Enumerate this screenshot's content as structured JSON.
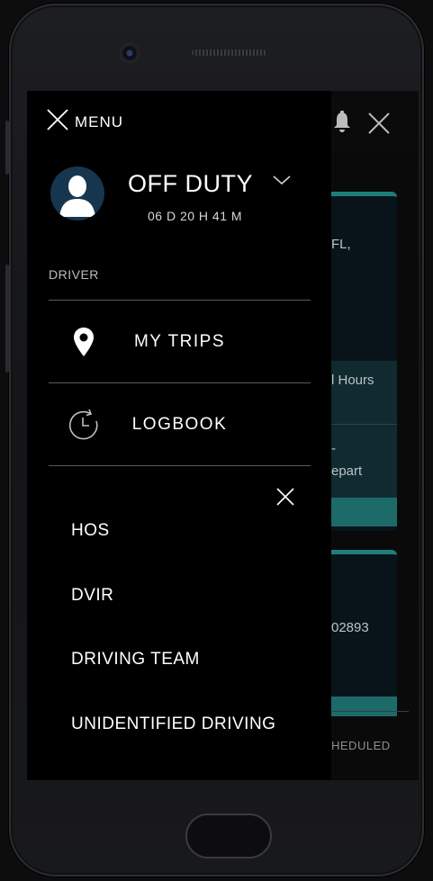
{
  "drawer": {
    "menu_label": "MENU",
    "status": {
      "title": "OFF DUTY",
      "time": "06 D 20 H 41 M"
    },
    "role": "DRIVER",
    "nav": [
      {
        "label": "MY TRIPS",
        "icon": "location-pin-icon"
      },
      {
        "label": "LOGBOOK",
        "icon": "history-clock-icon"
      }
    ],
    "submenu": [
      "HOS",
      "DVIR",
      "DRIVING TEAM",
      "UNIDENTIFIED DRIVING"
    ]
  },
  "background": {
    "card1": {
      "line1": "FL,",
      "line2": "l Hours",
      "line3": "-",
      "line4": "epart"
    },
    "card2": {
      "line1": "02893"
    },
    "footer_tab": "HEDULED"
  },
  "colors": {
    "accent_teal": "#1e7f79",
    "avatar_bg": "#163650"
  }
}
